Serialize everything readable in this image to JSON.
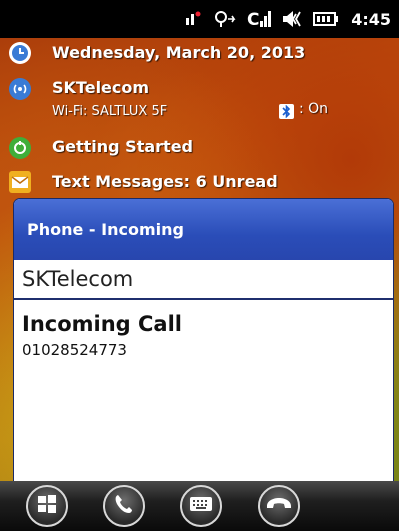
{
  "status_bar": {
    "icons": [
      "volume-icon",
      "sync-icon",
      "signal-icon",
      "speaker-icon",
      "battery-icon"
    ],
    "time": "4:45"
  },
  "today": {
    "date": "Wednesday, March 20, 2013",
    "carrier": "SKTelecom",
    "wifi": "Wi-Fi: SALTLUX 5F",
    "bluetooth_status": ": On",
    "getting_started": "Getting Started",
    "messages": "Text Messages: 6 Unread"
  },
  "dialog": {
    "title": "Phone - Incoming",
    "caller_name": "SKTelecom",
    "call_status": "Incoming Call",
    "number": "01028524773"
  },
  "bottom_bar": {
    "buttons": [
      "windows-start",
      "answer-call",
      "keyboard",
      "end-call"
    ]
  }
}
